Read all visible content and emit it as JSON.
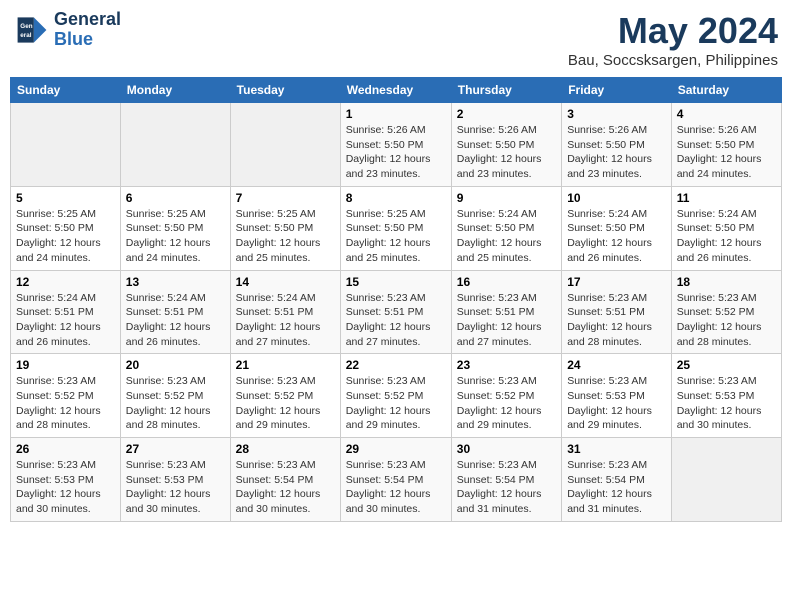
{
  "header": {
    "logo_line1": "General",
    "logo_line2": "Blue",
    "month": "May 2024",
    "location": "Bau, Soccsksargen, Philippines"
  },
  "weekdays": [
    "Sunday",
    "Monday",
    "Tuesday",
    "Wednesday",
    "Thursday",
    "Friday",
    "Saturday"
  ],
  "weeks": [
    [
      {
        "day": "",
        "sunrise": "",
        "sunset": "",
        "daylight": ""
      },
      {
        "day": "",
        "sunrise": "",
        "sunset": "",
        "daylight": ""
      },
      {
        "day": "",
        "sunrise": "",
        "sunset": "",
        "daylight": ""
      },
      {
        "day": "1",
        "sunrise": "Sunrise: 5:26 AM",
        "sunset": "Sunset: 5:50 PM",
        "daylight": "Daylight: 12 hours and 23 minutes."
      },
      {
        "day": "2",
        "sunrise": "Sunrise: 5:26 AM",
        "sunset": "Sunset: 5:50 PM",
        "daylight": "Daylight: 12 hours and 23 minutes."
      },
      {
        "day": "3",
        "sunrise": "Sunrise: 5:26 AM",
        "sunset": "Sunset: 5:50 PM",
        "daylight": "Daylight: 12 hours and 23 minutes."
      },
      {
        "day": "4",
        "sunrise": "Sunrise: 5:26 AM",
        "sunset": "Sunset: 5:50 PM",
        "daylight": "Daylight: 12 hours and 24 minutes."
      }
    ],
    [
      {
        "day": "5",
        "sunrise": "Sunrise: 5:25 AM",
        "sunset": "Sunset: 5:50 PM",
        "daylight": "Daylight: 12 hours and 24 minutes."
      },
      {
        "day": "6",
        "sunrise": "Sunrise: 5:25 AM",
        "sunset": "Sunset: 5:50 PM",
        "daylight": "Daylight: 12 hours and 24 minutes."
      },
      {
        "day": "7",
        "sunrise": "Sunrise: 5:25 AM",
        "sunset": "Sunset: 5:50 PM",
        "daylight": "Daylight: 12 hours and 25 minutes."
      },
      {
        "day": "8",
        "sunrise": "Sunrise: 5:25 AM",
        "sunset": "Sunset: 5:50 PM",
        "daylight": "Daylight: 12 hours and 25 minutes."
      },
      {
        "day": "9",
        "sunrise": "Sunrise: 5:24 AM",
        "sunset": "Sunset: 5:50 PM",
        "daylight": "Daylight: 12 hours and 25 minutes."
      },
      {
        "day": "10",
        "sunrise": "Sunrise: 5:24 AM",
        "sunset": "Sunset: 5:50 PM",
        "daylight": "Daylight: 12 hours and 26 minutes."
      },
      {
        "day": "11",
        "sunrise": "Sunrise: 5:24 AM",
        "sunset": "Sunset: 5:50 PM",
        "daylight": "Daylight: 12 hours and 26 minutes."
      }
    ],
    [
      {
        "day": "12",
        "sunrise": "Sunrise: 5:24 AM",
        "sunset": "Sunset: 5:51 PM",
        "daylight": "Daylight: 12 hours and 26 minutes."
      },
      {
        "day": "13",
        "sunrise": "Sunrise: 5:24 AM",
        "sunset": "Sunset: 5:51 PM",
        "daylight": "Daylight: 12 hours and 26 minutes."
      },
      {
        "day": "14",
        "sunrise": "Sunrise: 5:24 AM",
        "sunset": "Sunset: 5:51 PM",
        "daylight": "Daylight: 12 hours and 27 minutes."
      },
      {
        "day": "15",
        "sunrise": "Sunrise: 5:23 AM",
        "sunset": "Sunset: 5:51 PM",
        "daylight": "Daylight: 12 hours and 27 minutes."
      },
      {
        "day": "16",
        "sunrise": "Sunrise: 5:23 AM",
        "sunset": "Sunset: 5:51 PM",
        "daylight": "Daylight: 12 hours and 27 minutes."
      },
      {
        "day": "17",
        "sunrise": "Sunrise: 5:23 AM",
        "sunset": "Sunset: 5:51 PM",
        "daylight": "Daylight: 12 hours and 28 minutes."
      },
      {
        "day": "18",
        "sunrise": "Sunrise: 5:23 AM",
        "sunset": "Sunset: 5:52 PM",
        "daylight": "Daylight: 12 hours and 28 minutes."
      }
    ],
    [
      {
        "day": "19",
        "sunrise": "Sunrise: 5:23 AM",
        "sunset": "Sunset: 5:52 PM",
        "daylight": "Daylight: 12 hours and 28 minutes."
      },
      {
        "day": "20",
        "sunrise": "Sunrise: 5:23 AM",
        "sunset": "Sunset: 5:52 PM",
        "daylight": "Daylight: 12 hours and 28 minutes."
      },
      {
        "day": "21",
        "sunrise": "Sunrise: 5:23 AM",
        "sunset": "Sunset: 5:52 PM",
        "daylight": "Daylight: 12 hours and 29 minutes."
      },
      {
        "day": "22",
        "sunrise": "Sunrise: 5:23 AM",
        "sunset": "Sunset: 5:52 PM",
        "daylight": "Daylight: 12 hours and 29 minutes."
      },
      {
        "day": "23",
        "sunrise": "Sunrise: 5:23 AM",
        "sunset": "Sunset: 5:52 PM",
        "daylight": "Daylight: 12 hours and 29 minutes."
      },
      {
        "day": "24",
        "sunrise": "Sunrise: 5:23 AM",
        "sunset": "Sunset: 5:53 PM",
        "daylight": "Daylight: 12 hours and 29 minutes."
      },
      {
        "day": "25",
        "sunrise": "Sunrise: 5:23 AM",
        "sunset": "Sunset: 5:53 PM",
        "daylight": "Daylight: 12 hours and 30 minutes."
      }
    ],
    [
      {
        "day": "26",
        "sunrise": "Sunrise: 5:23 AM",
        "sunset": "Sunset: 5:53 PM",
        "daylight": "Daylight: 12 hours and 30 minutes."
      },
      {
        "day": "27",
        "sunrise": "Sunrise: 5:23 AM",
        "sunset": "Sunset: 5:53 PM",
        "daylight": "Daylight: 12 hours and 30 minutes."
      },
      {
        "day": "28",
        "sunrise": "Sunrise: 5:23 AM",
        "sunset": "Sunset: 5:54 PM",
        "daylight": "Daylight: 12 hours and 30 minutes."
      },
      {
        "day": "29",
        "sunrise": "Sunrise: 5:23 AM",
        "sunset": "Sunset: 5:54 PM",
        "daylight": "Daylight: 12 hours and 30 minutes."
      },
      {
        "day": "30",
        "sunrise": "Sunrise: 5:23 AM",
        "sunset": "Sunset: 5:54 PM",
        "daylight": "Daylight: 12 hours and 31 minutes."
      },
      {
        "day": "31",
        "sunrise": "Sunrise: 5:23 AM",
        "sunset": "Sunset: 5:54 PM",
        "daylight": "Daylight: 12 hours and 31 minutes."
      },
      {
        "day": "",
        "sunrise": "",
        "sunset": "",
        "daylight": ""
      }
    ]
  ]
}
